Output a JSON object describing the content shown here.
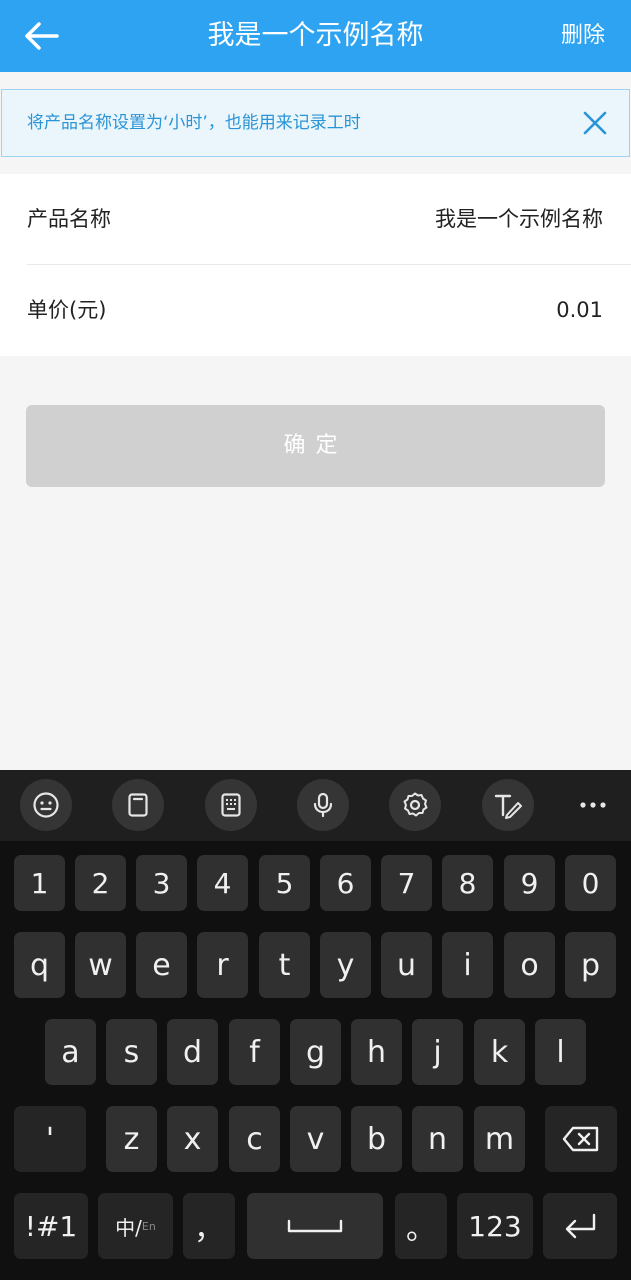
{
  "header": {
    "title": "我是一个示例名称",
    "delete_label": "删除",
    "background_color": "#2ea3f2"
  },
  "tip": {
    "text": "将产品名称设置为‘小时’，也能用来记录工时",
    "close_icon": "close-icon"
  },
  "form": {
    "product_name": {
      "label": "产品名称",
      "value": "我是一个示例名称"
    },
    "unit_price": {
      "label": "单价(元)",
      "value": "0.01"
    }
  },
  "confirm_label": "确定",
  "keyboard": {
    "toolbar_icons": [
      "emoji-icon",
      "clipboard-icon",
      "keypad-icon",
      "microphone-icon",
      "settings-icon",
      "handwriting-icon",
      "more-icon"
    ],
    "number_row": [
      "1",
      "2",
      "3",
      "4",
      "5",
      "6",
      "7",
      "8",
      "9",
      "0"
    ],
    "row1": [
      "q",
      "w",
      "e",
      "r",
      "t",
      "y",
      "u",
      "i",
      "o",
      "p"
    ],
    "row2": [
      "a",
      "s",
      "d",
      "f",
      "g",
      "h",
      "j",
      "k",
      "l"
    ],
    "row3": [
      "'",
      "z",
      "x",
      "c",
      "v",
      "b",
      "n",
      "m"
    ],
    "bottom": {
      "symbols": "!#1",
      "lang_main": "中/",
      "lang_sub": "En",
      "comma": "，",
      "period": "。",
      "numbers": "123"
    }
  }
}
